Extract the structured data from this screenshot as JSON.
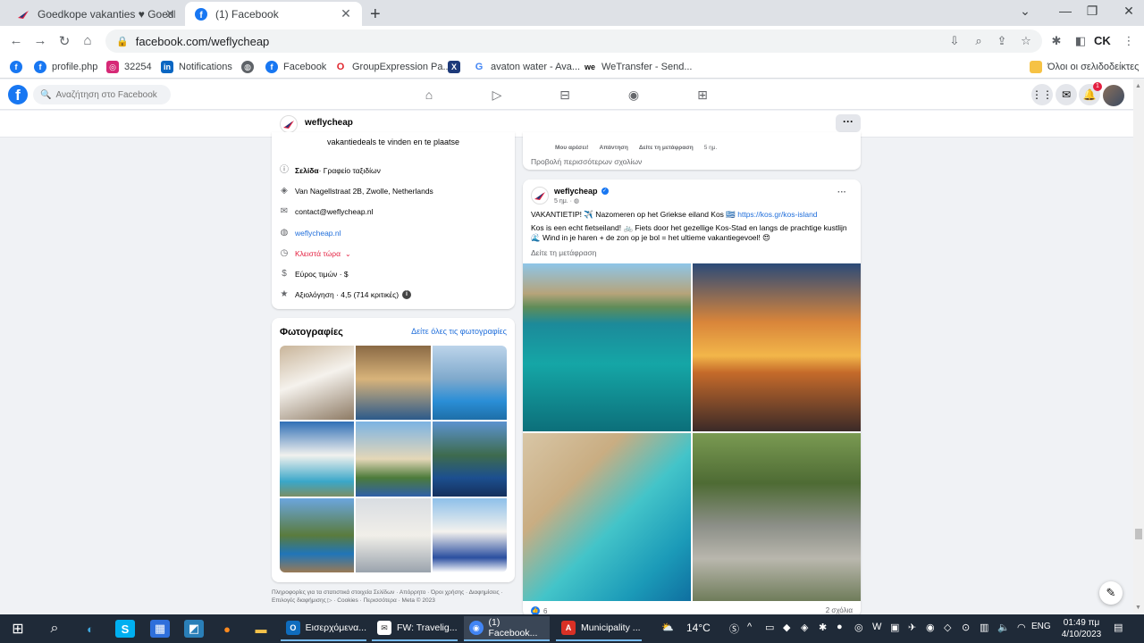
{
  "browser": {
    "tabs": [
      {
        "label": "Goedkope vakanties ♥ Goedkop",
        "active": false
      },
      {
        "label": "(1) Facebook",
        "active": true
      }
    ],
    "url": "facebook.com/weflycheap",
    "bookmarks": [
      {
        "label": "",
        "icon": "facebook-icon",
        "color": "#1877f2"
      },
      {
        "label": "profile.php",
        "icon": "facebook-icon",
        "color": "#1877f2"
      },
      {
        "label": "32254",
        "icon": "instagram-icon",
        "color": "#d62976"
      },
      {
        "label": "Notifications",
        "icon": "linkedin-icon",
        "color": "#0a66c2"
      },
      {
        "label": "",
        "icon": "globe-icon",
        "color": "#5f6368"
      },
      {
        "label": "Facebook",
        "icon": "facebook-icon",
        "color": "#1877f2"
      },
      {
        "label": "GroupExpression Pa...",
        "icon": "opera-icon",
        "color": "#e0252c"
      },
      {
        "label": "",
        "icon": "x-icon",
        "color": "#1d3a7a"
      },
      {
        "label": "avaton water - Ava...",
        "icon": "google-icon",
        "color": "#ffffff"
      },
      {
        "label": "WeTransfer - Send...",
        "icon": "wetransfer-icon",
        "color": "#ffffff"
      }
    ],
    "all_bookmarks": "Όλοι οι σελιδοδείκτες"
  },
  "fb": {
    "search_placeholder": "Αναζήτηση στο Facebook",
    "notif_count": "1",
    "page_name": "weflycheap",
    "more_btn": "···"
  },
  "intro": {
    "bio": "vakantiedeals te vinden en te plaatse",
    "category_bold": "Σελίδα",
    "category": " · Γραφείο ταξιδίων",
    "address": "Van Nagellstraat 2B, Zwolle, Netherlands",
    "email": "contact@weflycheap.nl",
    "website": "weflycheap.nl",
    "hours": "Κλειστά τώρα",
    "price": "Εύρος τιμών · $",
    "rating": "Αξιολόγηση · 4,5 (714 κριτικές)"
  },
  "photos": {
    "title": "Φωτογραφίες",
    "see_all": "Δείτε όλες τις φωτογραφίες"
  },
  "footer": "Πληροφορίες για τα στατιστικά στοιχεία Σελίδων · Απόρρητο · Όροι χρήσης · Διαφημίσεις · Επιλογές διαφήμισης ▷ · Cookies · Περισσότερα · Meta © 2023",
  "comments": {
    "like": "Μου αρέσει!",
    "reply": "Απάντηση",
    "translate": "Δείτε τη μετάφραση",
    "time": "5 ημ.",
    "more": "Προβολή περισσότερων σχολίων"
  },
  "post": {
    "author": "weflycheap",
    "time": "5 ημ. · ",
    "line1": "VAKANTIETIP! ✈️ Nazomeren op het Griekse eiland Kos 🇬🇷 ",
    "line1_link": "https://kos.gr/kos-island",
    "line2": "Kos is een echt fietseiland! 🚲 Fiets door het gezellige Kos-Stad en langs de prachtige kustlijn 🌊 Wind in je haren + de zon op je bol = het ultieme vakantiegevoel! 😍",
    "translate": "Δείτε τη μετάφραση",
    "reactions": "6",
    "comment_count": "2 σχόλια"
  },
  "taskbar": {
    "apps": [
      {
        "label": "Εισερχόμενα...",
        "icon": "outlook-icon",
        "color": "#0f6cbd"
      },
      {
        "label": "FW: Travelig...",
        "icon": "mail-icon",
        "color": "#ffffff"
      },
      {
        "label": "(1) Facebook...",
        "icon": "chrome-icon",
        "color": "#4285f4"
      },
      {
        "label": "Municipality ...",
        "icon": "pdf-icon",
        "color": "#d93025"
      }
    ],
    "weather": "14°C",
    "lang": "ENG",
    "time": "01:49 πμ",
    "date": "4/10/2023"
  },
  "colors": {
    "fb_blue": "#1877f2",
    "link": "#216fdb",
    "closed_red": "#e41e3f"
  }
}
